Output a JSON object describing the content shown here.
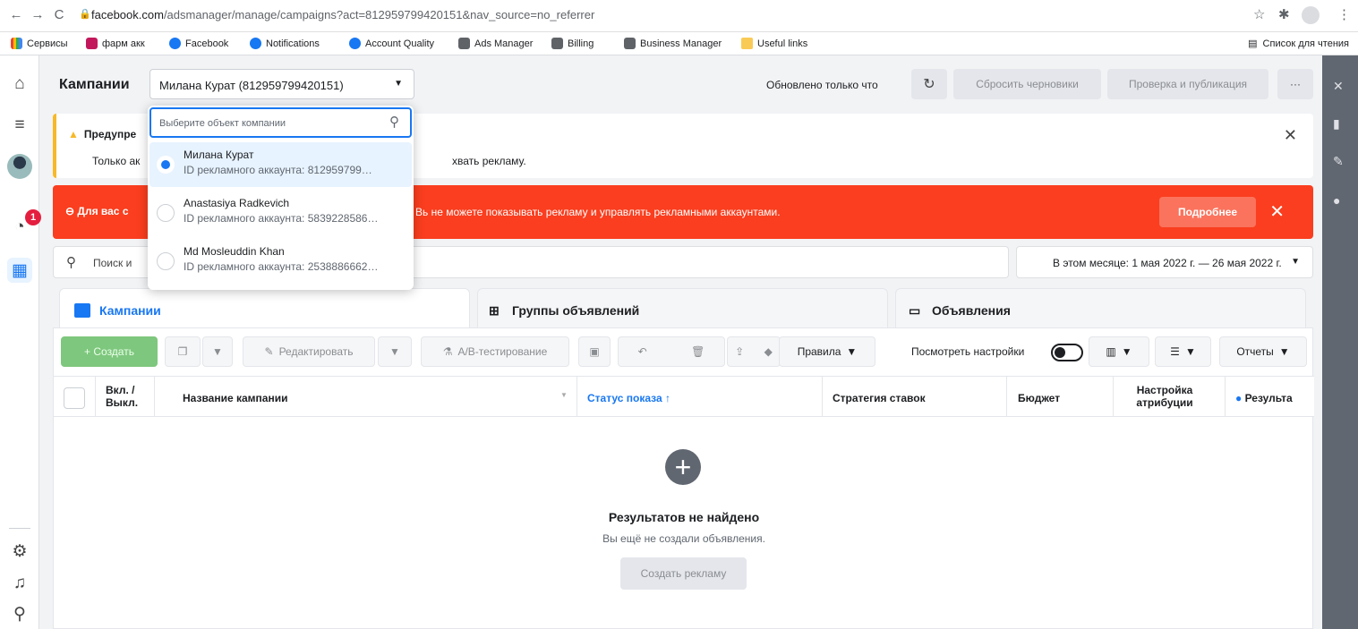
{
  "browser": {
    "url_host": "facebook.com",
    "url_rest": "/adsmanager/manage/campaigns?act=812959799420151&nav_source=no_referrer",
    "bookmarks": [
      "Сервисы",
      "фарм акк",
      "Facebook",
      "Notifications",
      "Account Quality",
      "Ads Manager",
      "Billing",
      "Business Manager",
      "Useful links"
    ],
    "reading_list": "Список для чтения"
  },
  "header": {
    "title": "Кампании",
    "account_selected": "Милана Курат (812959799420151)",
    "updated": "Обновлено только что",
    "reset_drafts": "Сбросить черновики",
    "review_publish": "Проверка и публикация",
    "more": "···"
  },
  "warning": {
    "title": "Предупре",
    "text": "Только ак",
    "text_tail": "хвать рекламу."
  },
  "error": {
    "title": "Для вас с",
    "text": "Вь  не можете показывать рекламу и управлять рекламными аккаунтами.",
    "more_button": "Подробнее"
  },
  "search": {
    "placeholder": "Поиск и",
    "date_range": "В этом месяце: 1 мая 2022 г. — 26 мая 2022 г."
  },
  "tabs": [
    {
      "label": "Кампании"
    },
    {
      "label": "Группы объявлений"
    },
    {
      "label": "Объявления"
    }
  ],
  "toolbar": {
    "create": "+ Создать",
    "edit": "Редактировать",
    "ab_test": "A/B-тестирование",
    "rules": "Правила",
    "view_settings": "Посмотреть настройки",
    "reports": "Отчеты"
  },
  "table": {
    "headers": {
      "onoff": "Вкл. / Выкл.",
      "name": "Название кампании",
      "status": "Статус показа ↑",
      "bid": "Стратегия ставок",
      "budget": "Бюджет",
      "attribution": "Настройка атрибуции",
      "results": "Результа"
    }
  },
  "empty": {
    "title": "Результатов не найдено",
    "subtitle": "Вы ещё не создали объявления.",
    "button": "Создать рекламу"
  },
  "dropdown": {
    "placeholder": "Выберите объект компании",
    "items": [
      {
        "name": "Милана Курат",
        "id": "ID рекламного аккаунта: 812959799…",
        "selected": true
      },
      {
        "name": "Anastasiya Radkevich",
        "id": "ID рекламного аккаунта: 5839228586…",
        "selected": false
      },
      {
        "name": "Md Mosleuddin Khan",
        "id": "ID рекламного аккаунта: 2538886662…",
        "selected": false
      }
    ]
  },
  "rail": {
    "badge": "1"
  },
  "colors": {
    "accent": "#1877f2",
    "error": "#fa3e1f",
    "warning": "#f7b928",
    "create": "#7ec77e"
  }
}
